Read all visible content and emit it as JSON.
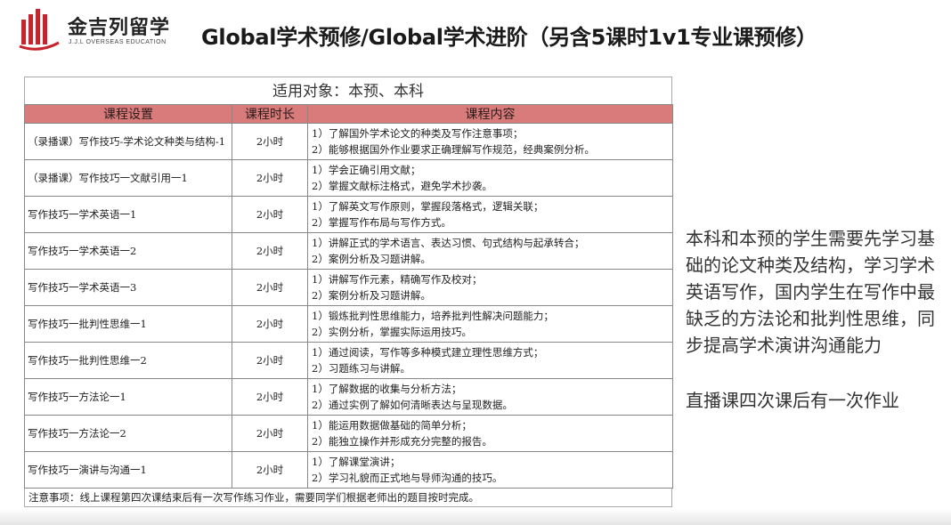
{
  "logo": {
    "cn": "金吉列留学",
    "en": "J.J.L OVERSEAS EDUCATION",
    "brand_color": "#c8232c"
  },
  "title": "Global学术预修/Global学术进阶（另含5课时1v1专业课预修）",
  "table": {
    "audience": "适用对象：本预、本科",
    "header_color": "#d97b7b",
    "columns": [
      "课程设置",
      "课程时长",
      "课程内容"
    ],
    "rows": [
      {
        "course": "（录播课）写作技巧-学术论文种类与结构-1",
        "duration": "2小时",
        "content": [
          "1）了解国外学术论文的种类及写作注意事项；",
          "2）能够根据国外作业要求正确理解写作规范，经典案例分析。"
        ]
      },
      {
        "course": "（录播课）写作技巧一文献引用一1",
        "duration": "2小时",
        "content": [
          "1）学会正确引用文献；",
          "2）掌握文献标注格式，避免学术抄袭。"
        ]
      },
      {
        "course": "写作技巧一学术英语一1",
        "duration": "2小时",
        "content": [
          "1）了解英文写作原则，掌握段落格式，逻辑关联；",
          "2）掌握写作布局与写作方式。"
        ]
      },
      {
        "course": "写作技巧一学术英语一2",
        "duration": "2小时",
        "content": [
          "1）讲解正式的学术语言、表达习惯、句式结构与起承转合；",
          "2）案例分析及习题讲解。"
        ]
      },
      {
        "course": "写作技巧一学术英语一3",
        "duration": "2小时",
        "content": [
          "1）讲解写作元素，精确写作及校对；",
          "2）案例分析及习题讲解。"
        ]
      },
      {
        "course": "写作技巧一批判性思维一1",
        "duration": "2小时",
        "content": [
          "1）锻炼批判性思维能力，培养批判性解决问题能力；",
          "2）实例分析，掌握实际运用技巧。"
        ]
      },
      {
        "course": "写作技巧一批判性思维一2",
        "duration": "2小时",
        "content": [
          "1）通过阅读，写作等多种模式建立理性思维方式；",
          "2）习题练习与讲解。"
        ]
      },
      {
        "course": "写作技巧一方法论一1",
        "duration": "2小时",
        "content": [
          "1）了解数据的收集与分析方法；",
          "2）通过实例了解如何清晰表达与呈现数据。"
        ]
      },
      {
        "course": "写作技巧一方法论一2",
        "duration": "2小时",
        "content": [
          "1）能运用数据做基础的简单分析；",
          "2）能独立操作并形成充分完整的报告。"
        ]
      },
      {
        "course": "写作技巧一演讲与沟通一1",
        "duration": "2小时",
        "content": [
          "1）了解课堂演讲；",
          "2）学习礼貌而正式地与导师沟通的技巧。"
        ]
      }
    ],
    "note": "注意事项：线上课程第四次课结束后有一次写作练习作业，需要同学们根据老师出的题目按时完成。"
  },
  "side": {
    "paragraph1": "本科和本预的学生需要先学习基础的论文种类及结构，学习学术英语写作，国内学生在写作中最缺乏的方法论和批判性思维，同步提高学术演讲沟通能力",
    "paragraph2": "直播课四次课后有一次作业"
  }
}
